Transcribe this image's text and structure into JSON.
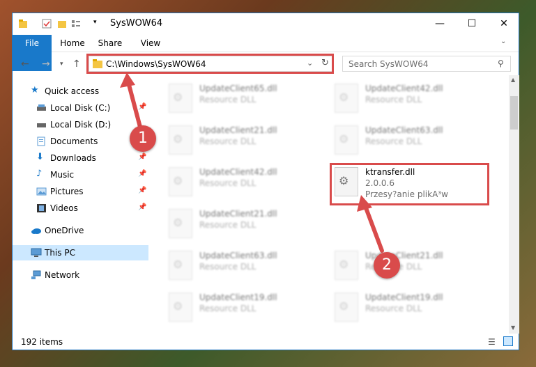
{
  "window": {
    "title": "SysWOW64",
    "controls": {
      "minimize": "—",
      "maximize": "☐",
      "close": "✕"
    }
  },
  "ribbon": {
    "tabs": [
      "File",
      "Home",
      "Share",
      "View"
    ]
  },
  "navigation": {
    "address": "C:\\Windows\\SysWOW64",
    "search_placeholder": "Search SysWOW64"
  },
  "sidebar": {
    "items": [
      {
        "label": "Quick access",
        "icon": "star-icon",
        "pinned": false
      },
      {
        "label": "Local Disk (C:)",
        "icon": "drive-icon",
        "pinned": true
      },
      {
        "label": "Local Disk (D:)",
        "icon": "drive-icon",
        "pinned": false
      },
      {
        "label": "Documents",
        "icon": "documents-icon",
        "pinned": true
      },
      {
        "label": "Downloads",
        "icon": "download-icon",
        "pinned": true
      },
      {
        "label": "Music",
        "icon": "music-icon",
        "pinned": true
      },
      {
        "label": "Pictures",
        "icon": "pictures-icon",
        "pinned": true
      },
      {
        "label": "Videos",
        "icon": "videos-icon",
        "pinned": true
      },
      {
        "label": "OneDrive",
        "icon": "cloud-icon",
        "pinned": false
      },
      {
        "label": "This PC",
        "icon": "pc-icon",
        "pinned": false
      },
      {
        "label": "Network",
        "icon": "network-icon",
        "pinned": false
      }
    ]
  },
  "files": {
    "left": [
      {
        "name": "UpdateClient65.dll",
        "type": "Resource DLL"
      },
      {
        "name": "UpdateClient21.dll",
        "type": "Resource DLL"
      },
      {
        "name": "UpdateClient42.dll",
        "type": "Resource DLL"
      },
      {
        "name": "UpdateClient21.dll",
        "type": "Resource DLL"
      },
      {
        "name": "UpdateClient63.dll",
        "type": "Resource DLL"
      },
      {
        "name": "UpdateClient19.dll",
        "type": "Resource DLL"
      }
    ],
    "right": [
      {
        "name": "UpdateClient42.dll",
        "type": "Resource DLL"
      },
      {
        "name": "UpdateClient63.dll",
        "type": "Resource DLL"
      },
      {
        "name": "ktransfer.dll",
        "type": "2.0.0.6",
        "extra": "Przesy?anie plikA³w"
      },
      {
        "name": "UpdateClient21.dll",
        "type": "Resource DLL"
      },
      {
        "name": "UpdateClient19.dll",
        "type": "Resource DLL"
      }
    ]
  },
  "status": {
    "item_count": "192 items"
  },
  "annotations": {
    "step1": "1",
    "step2": "2"
  },
  "colors": {
    "accent": "#1979ca",
    "highlight": "#d94b4b",
    "selected": "#cce8ff"
  }
}
